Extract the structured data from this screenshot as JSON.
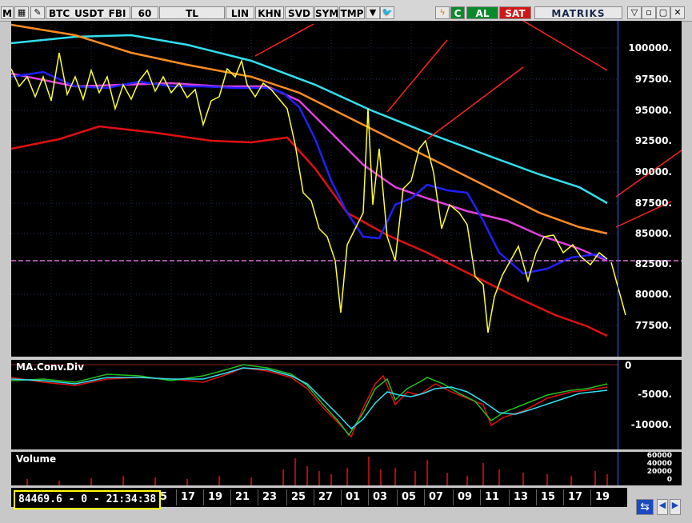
{
  "toolbar": {
    "m_label": "M",
    "symbol": "BTC_USDT_FBI",
    "interval": "60",
    "currency": "TL",
    "lin": "LIN",
    "khn": "KHN",
    "svd": "SVD",
    "sym": "SYM",
    "tmp": "TMP",
    "buy": "AL",
    "sell": "SAT",
    "brand": "MATRIKS",
    "c_label": "C"
  },
  "main_axis": [
    "100000.",
    "97500.",
    "95000.",
    "92500.",
    "90000.",
    "87500.",
    "85000.",
    "82500.",
    "80000.",
    "77500."
  ],
  "macd": {
    "title": "MA.Conv.Div",
    "axis": [
      "0",
      "-5000.",
      "-10000."
    ]
  },
  "volume": {
    "title": "Volume",
    "axis": [
      "60000",
      "40000",
      "20000",
      "0"
    ]
  },
  "x_axis": [
    "5",
    "17",
    "19",
    "21",
    "23",
    "25",
    "27",
    "01",
    "03",
    "05",
    "07",
    "09",
    "11",
    "13",
    "15",
    "17",
    "19"
  ],
  "status": "84469.6 - 0 - 21:34:38",
  "colors": {
    "price": "#ffff33",
    "ma_blue": "#2020ff",
    "ma_magenta": "#e040e0",
    "ma_orange": "#ff8c20",
    "ma_cyan": "#30e0f0",
    "ma_red": "#e01010",
    "trend": "#ff2020"
  }
}
